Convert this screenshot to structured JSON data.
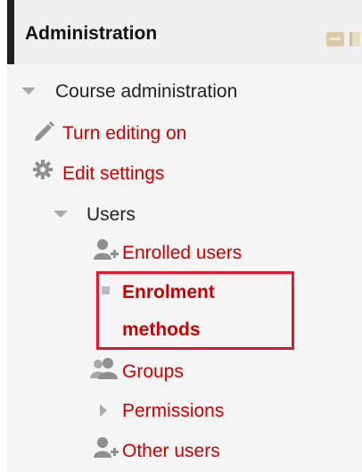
{
  "block": {
    "title": "Administration"
  },
  "tree": {
    "course_admin": {
      "label": "Course administration"
    },
    "turn_editing": {
      "label": "Turn editing on",
      "icon": "pencil-icon"
    },
    "edit_settings": {
      "label": "Edit settings",
      "icon": "gear-icon"
    },
    "users": {
      "label": "Users"
    },
    "enrolled_users": {
      "label": "Enrolled users",
      "icon": "user-add-icon"
    },
    "enrolment_methods": {
      "line1": "Enrolment",
      "line2": "methods"
    },
    "groups": {
      "label": "Groups",
      "icon": "group-icon"
    },
    "permissions": {
      "label": "Permissions"
    },
    "other_users": {
      "label": "Other users",
      "icon": "user-add-icon"
    }
  },
  "colors": {
    "link": "#cc0000",
    "highlight_border": "#e0182b",
    "header_bar": "#222222"
  }
}
